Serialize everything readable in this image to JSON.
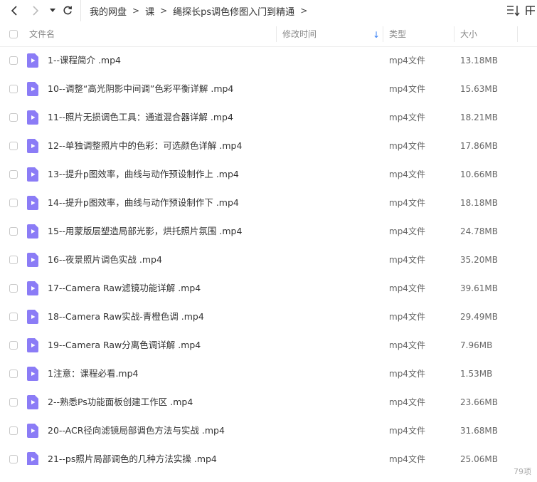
{
  "breadcrumb": [
    "我的网盘",
    "课",
    "绳探长ps调色修图入门到精通"
  ],
  "breadcrumb_sep": ">",
  "columns": {
    "name": "文件名",
    "modified": "修改时间",
    "type": "类型",
    "size": "大小"
  },
  "files": [
    {
      "name": "1--课程简介 .mp4",
      "type": "mp4文件",
      "size": "13.18MB"
    },
    {
      "name": "10--调整“高光阴影中间调”色彩平衡详解 .mp4",
      "type": "mp4文件",
      "size": "15.63MB"
    },
    {
      "name": "11--照片无损调色工具：通道混合器详解 .mp4",
      "type": "mp4文件",
      "size": "18.21MB"
    },
    {
      "name": "12--单独调整照片中的色彩：可选颜色详解 .mp4",
      "type": "mp4文件",
      "size": "17.86MB"
    },
    {
      "name": "13--提升p图效率，曲线与动作预设制作上 .mp4",
      "type": "mp4文件",
      "size": "10.66MB"
    },
    {
      "name": "14--提升p图效率，曲线与动作预设制作下 .mp4",
      "type": "mp4文件",
      "size": "18.18MB"
    },
    {
      "name": "15--用蒙版层塑造局部光影，烘托照片氛围 .mp4",
      "type": "mp4文件",
      "size": "24.78MB"
    },
    {
      "name": "16--夜景照片调色实战 .mp4",
      "type": "mp4文件",
      "size": "35.20MB"
    },
    {
      "name": "17--Camera Raw滤镜功能详解 .mp4",
      "type": "mp4文件",
      "size": "39.61MB"
    },
    {
      "name": "18--Camera Raw实战-青橙色调 .mp4",
      "type": "mp4文件",
      "size": "29.49MB"
    },
    {
      "name": "19--Camera Raw分离色调详解 .mp4",
      "type": "mp4文件",
      "size": "7.96MB"
    },
    {
      "name": "1注意：课程必看.mp4",
      "type": "mp4文件",
      "size": "1.53MB"
    },
    {
      "name": "2--熟悉Ps功能面板创建工作区 .mp4",
      "type": "mp4文件",
      "size": "23.66MB"
    },
    {
      "name": "20--ACR径向滤镜局部调色方法与实战 .mp4",
      "type": "mp4文件",
      "size": "31.68MB"
    },
    {
      "name": "21--ps照片局部调色的几种方法实操 .mp4",
      "type": "mp4文件",
      "size": "25.06MB"
    }
  ],
  "item_count": "79项",
  "colors": {
    "file_icon": "#8b7cf6",
    "sort_arrow": "#3b82f6"
  }
}
